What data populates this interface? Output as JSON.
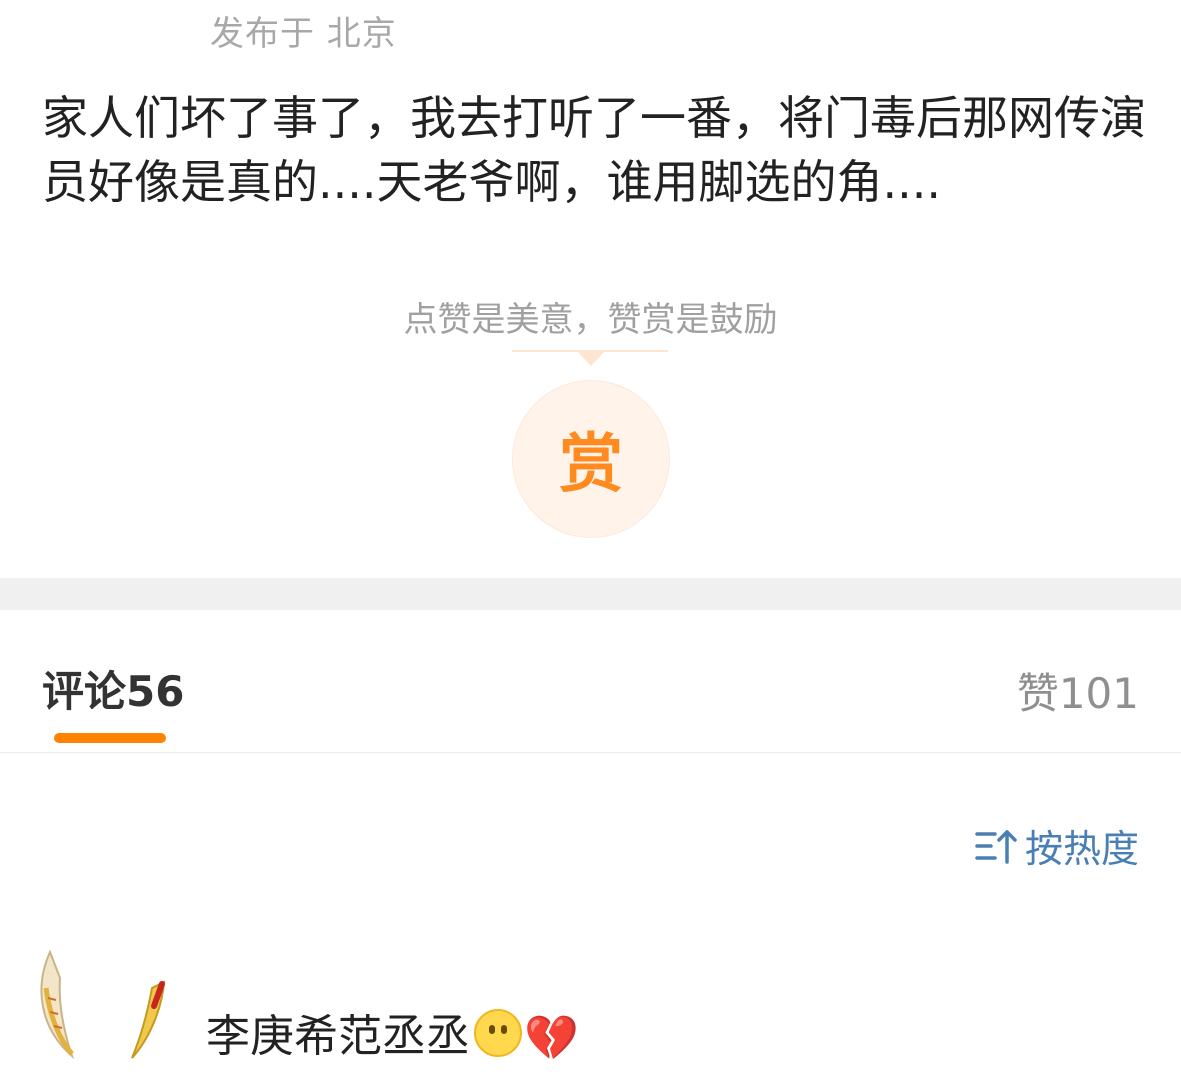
{
  "post": {
    "location": "发布于 北京",
    "body": "家人们坏了事了，我去打听了一番，将门毒后那网传演员好像是真的....天老爷啊，谁用脚选的角...."
  },
  "reward": {
    "hint": "点赞是美意，赞赏是鼓励",
    "button_label": "赏",
    "accent_color": "#ff8a1f"
  },
  "tabs": {
    "comments_label": "评论",
    "comments_count": "56",
    "likes_label": "赞",
    "likes_count": "101",
    "indicator_color": "#ff8200"
  },
  "sort": {
    "label": "按热度",
    "icon": "sort-icon",
    "color": "#4a7fb3"
  },
  "comment": {
    "text": "李庚希范丞丞",
    "emojis": [
      "emoji-face-icon",
      "broken-heart-icon"
    ],
    "avatar": "avatar"
  }
}
